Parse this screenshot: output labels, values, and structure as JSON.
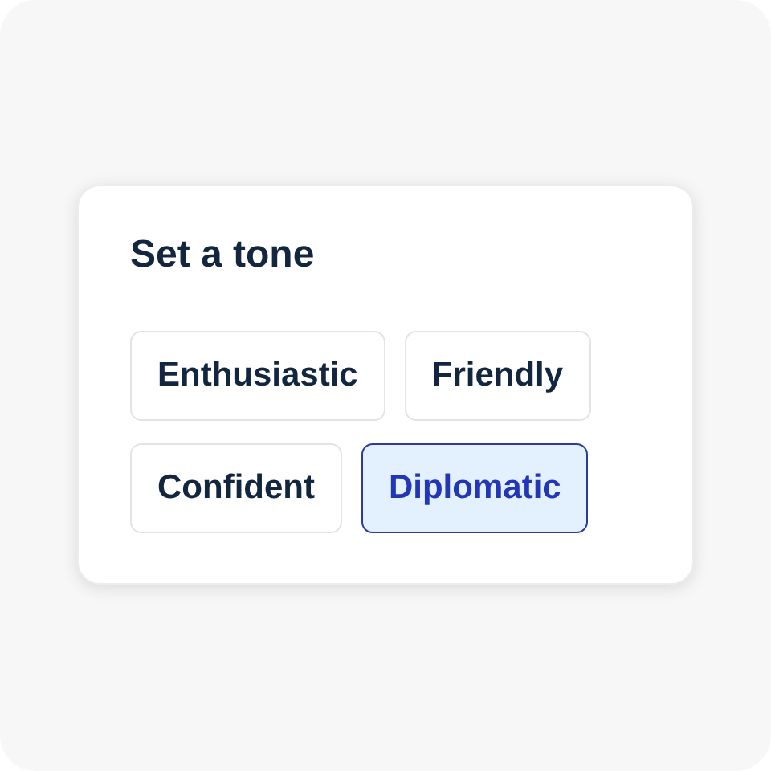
{
  "card": {
    "title": "Set a tone",
    "options": [
      {
        "label": "Enthusiastic",
        "selected": false
      },
      {
        "label": "Friendly",
        "selected": false
      },
      {
        "label": "Confident",
        "selected": false
      },
      {
        "label": "Diplomatic",
        "selected": true
      }
    ]
  }
}
